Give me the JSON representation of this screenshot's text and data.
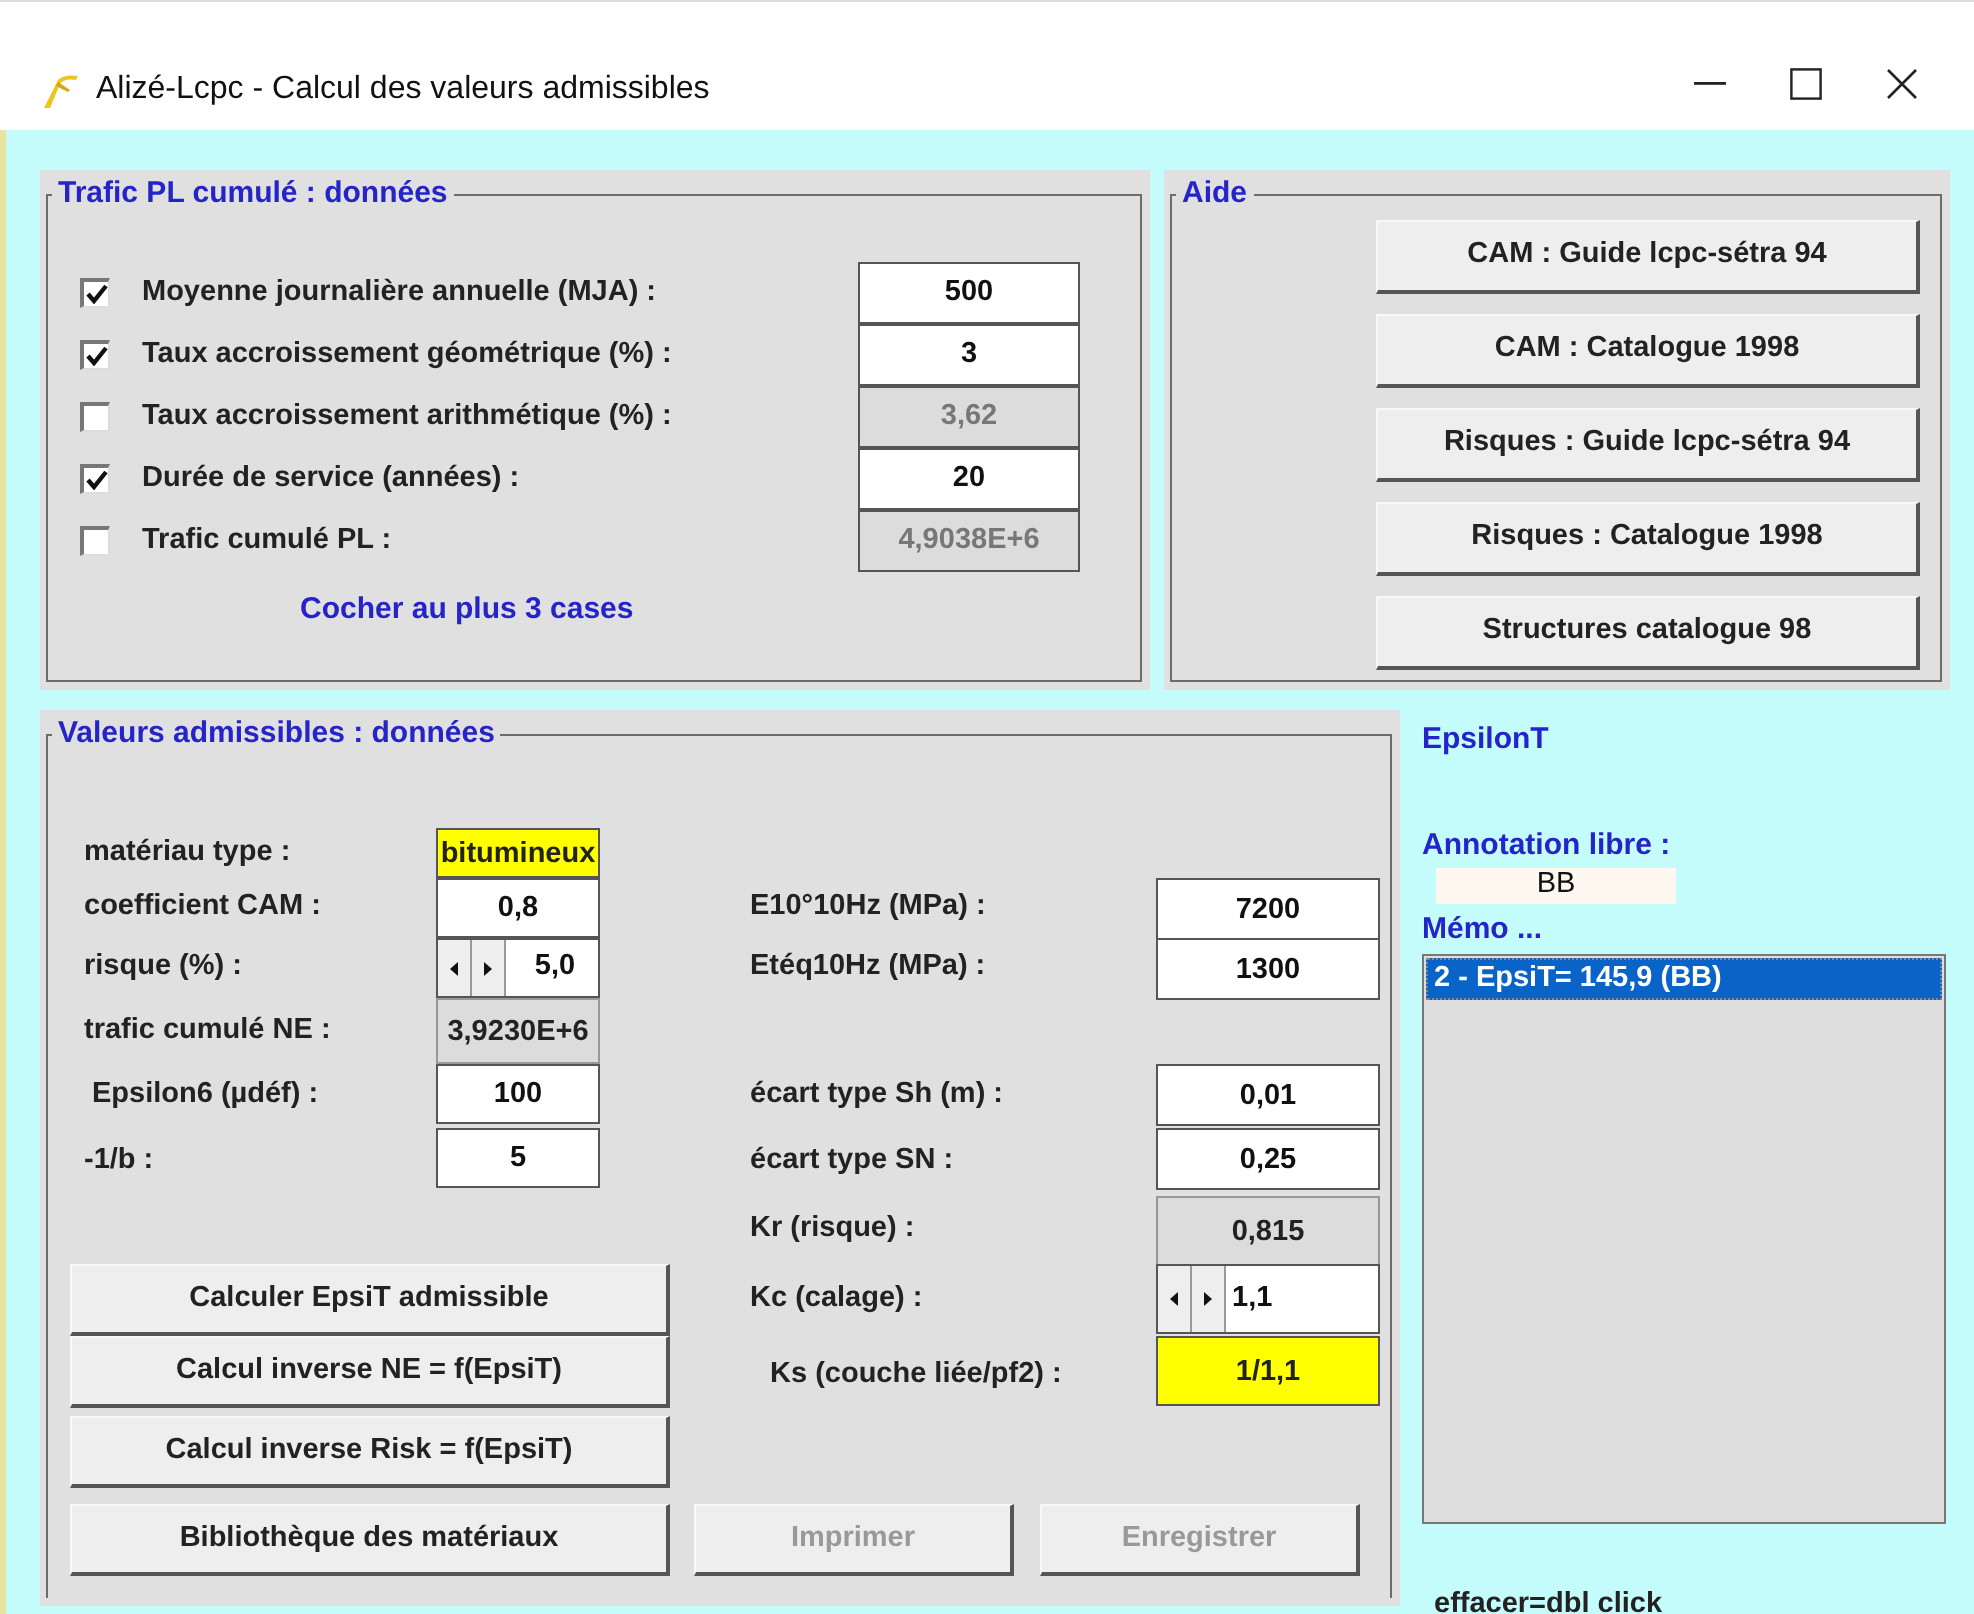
{
  "window": {
    "title": "Alizé-Lcpc - Calcul des valeurs admissibles"
  },
  "traffic": {
    "title": "Trafic PL cumulé : données",
    "rows": [
      {
        "label": "Moyenne journalière annuelle (MJA) :",
        "checked": true,
        "value": "500"
      },
      {
        "label": "Taux accroissement géométrique (%) :",
        "checked": true,
        "value": "3"
      },
      {
        "label": "Taux accroissement arithmétique (%) :",
        "checked": false,
        "value": "3,62"
      },
      {
        "label": "Durée de service  (années) :",
        "checked": true,
        "value": "20"
      },
      {
        "label": "Trafic cumulé PL :",
        "checked": false,
        "value": "4,9038E+6"
      }
    ],
    "note": "Cocher au plus 3 cases"
  },
  "help": {
    "title": "Aide",
    "buttons": [
      "CAM : Guide lcpc-sétra 94",
      "CAM : Catalogue 1998",
      "Risques : Guide lcpc-sétra 94",
      "Risques : Catalogue 1998",
      "Structures catalogue 98"
    ]
  },
  "values": {
    "title": "Valeurs admissibles : données",
    "left": [
      {
        "label": "matériau type :",
        "kind": "highlight",
        "value": "bitumineux"
      },
      {
        "label": "coefficient CAM :",
        "kind": "input",
        "value": "0,8"
      },
      {
        "label": "risque (%) :",
        "kind": "spin",
        "value": "5,0"
      },
      {
        "label": "trafic cumulé NE :",
        "kind": "readonly",
        "value": "3,9230E+6"
      },
      {
        "label": "Epsilon6 (µdéf) :",
        "kind": "input",
        "value": "100"
      },
      {
        "label": "-1/b :",
        "kind": "input",
        "value": "5"
      }
    ],
    "right": [
      {
        "label": "E10°10Hz (MPa) :",
        "kind": "input",
        "value": "7200"
      },
      {
        "label": "Etéq10Hz (MPa) :",
        "kind": "input",
        "value": "1300"
      },
      {
        "label": "écart type Sh (m) :",
        "kind": "input",
        "value": "0,01"
      },
      {
        "label": "écart type SN :",
        "kind": "input",
        "value": "0,25"
      },
      {
        "label": "Kr (risque) :",
        "kind": "readonly",
        "value": "0,815"
      },
      {
        "label": "Kc (calage) :",
        "kind": "spin",
        "value": "1,1"
      },
      {
        "label": "Ks (couche liée/pf2) :",
        "kind": "highlight",
        "value": "1/1,1"
      }
    ],
    "buttons": [
      "Calculer EpsiT admissible",
      "Calcul inverse NE = f(EpsiT)",
      "Calcul inverse Risk = f(EpsiT)",
      "Bibliothèque des matériaux"
    ],
    "bottom_buttons": [
      {
        "label": "Imprimer",
        "disabled": true
      },
      {
        "label": "Enregistrer",
        "disabled": true
      }
    ]
  },
  "side": {
    "result_label": "EpsilonT",
    "annotation_label": "Annotation libre :",
    "annotation_value": "BB",
    "memo_label": "Mémo ...",
    "memo_items": [
      {
        "text": "2 - EpsiT= 145,9 (BB)",
        "selected": true
      }
    ],
    "hint": "effacer=dbl click"
  }
}
